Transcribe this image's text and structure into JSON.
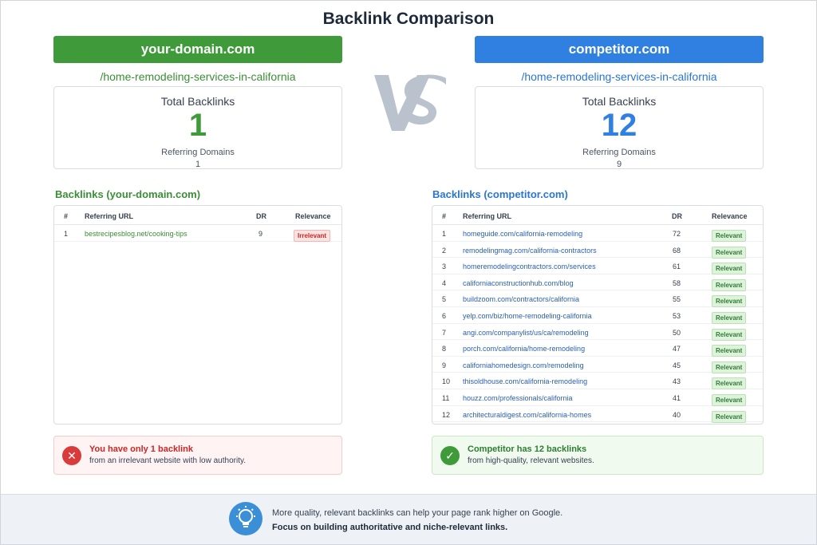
{
  "title": "Backlink Comparison",
  "left": {
    "domain": "your-domain.com",
    "path": "/home-remodeling-services-in-california",
    "total_label": "Total Backlinks",
    "total": "1",
    "rd_label": "Referring Domains",
    "rd_value": "1",
    "section_title": "Backlinks (your-domain.com)",
    "headers": {
      "num": "#",
      "url": "Referring URL",
      "dr": "DR",
      "rel": "Relevance"
    },
    "rows": [
      {
        "num": "1",
        "url": "bestrecipesblog.net/cooking-tips",
        "dr": "9",
        "rel": "Irrelevant"
      }
    ],
    "note_title": "You have only 1 backlink",
    "note_text": "from an irrelevant website with low authority.",
    "note_icon": "x-circle-icon"
  },
  "right": {
    "domain": "competitor.com",
    "path": "/home-remodeling-services-in-california",
    "total_label": "Total Backlinks",
    "total": "12",
    "rd_label": "Referring Domains",
    "rd_value": "9",
    "section_title": "Backlinks (competitor.com)",
    "headers": {
      "num": "#",
      "url": "Referring URL",
      "dr": "DR",
      "rel": "Relevance"
    },
    "rows": [
      {
        "num": "1",
        "url": "homeguide.com/california-remodeling",
        "dr": "72",
        "rel": "Relevant"
      },
      {
        "num": "2",
        "url": "remodelingmag.com/california-contractors",
        "dr": "68",
        "rel": "Relevant"
      },
      {
        "num": "3",
        "url": "homeremodelingcontractors.com/services",
        "dr": "61",
        "rel": "Relevant"
      },
      {
        "num": "4",
        "url": "californiaconstructionhub.com/blog",
        "dr": "58",
        "rel": "Relevant"
      },
      {
        "num": "5",
        "url": "buildzoom.com/contractors/california",
        "dr": "55",
        "rel": "Relevant"
      },
      {
        "num": "6",
        "url": "yelp.com/biz/home-remodeling-california",
        "dr": "53",
        "rel": "Relevant"
      },
      {
        "num": "7",
        "url": "angi.com/companylist/us/ca/remodeling",
        "dr": "50",
        "rel": "Relevant"
      },
      {
        "num": "8",
        "url": "porch.com/california/home-remodeling",
        "dr": "47",
        "rel": "Relevant"
      },
      {
        "num": "9",
        "url": "californiahomedesign.com/remodeling",
        "dr": "45",
        "rel": "Relevant"
      },
      {
        "num": "10",
        "url": "thisoldhouse.com/california-remodeling",
        "dr": "43",
        "rel": "Relevant"
      },
      {
        "num": "11",
        "url": "houzz.com/professionals/california",
        "dr": "41",
        "rel": "Relevant"
      },
      {
        "num": "12",
        "url": "architecturaldigest.com/california-homes",
        "dr": "40",
        "rel": "Relevant"
      }
    ],
    "note_title": "Competitor has 12 backlinks",
    "note_text": "from  high-quality, relevant websites.",
    "note_icon": "check-circle-icon"
  },
  "footer": {
    "line1": "More quality, relevant backlinks can help your page rank higher on Google.",
    "line2": "Focus on building authoritative and niche-relevant links.",
    "icon": "lightbulb-icon"
  },
  "colors": {
    "green": "#3f9a3a",
    "blue": "#2f80e0",
    "red": "#d93a3a"
  }
}
